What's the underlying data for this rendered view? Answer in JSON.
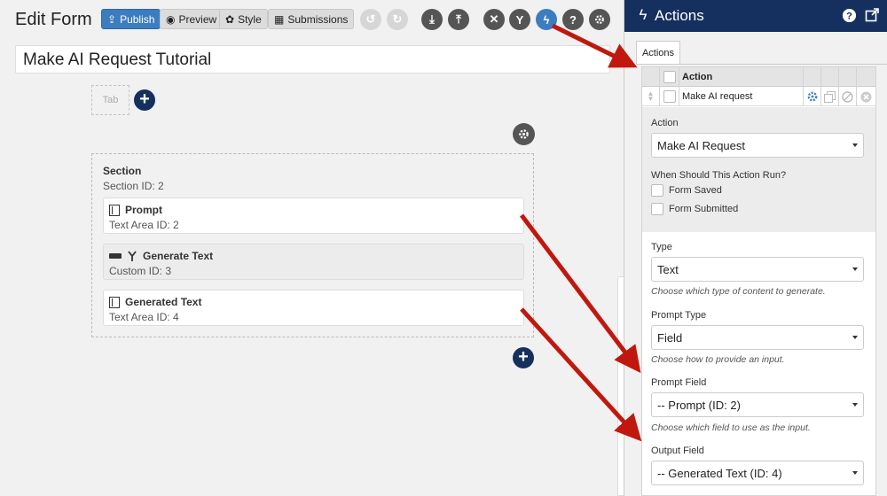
{
  "editor": {
    "title": "Edit Form",
    "toolbar": {
      "publish_label": "Publish",
      "preview_label": "Preview",
      "style_label": "Style",
      "submissions_label": "Submissions"
    },
    "form_title": "Make AI Request Tutorial",
    "tab_label": "Tab",
    "section": {
      "title": "Section",
      "subtitle": "Section  ID: 2",
      "fields": [
        {
          "name": "Prompt",
          "sub": "Text Area  ID: 2"
        },
        {
          "name": "Generate Text",
          "sub": "Custom  ID: 3"
        },
        {
          "name": "Generated Text",
          "sub": "Text Area  ID: 4"
        }
      ]
    }
  },
  "panel": {
    "title": "Actions",
    "tab_label": "Actions",
    "table": {
      "header": "Action",
      "rows": [
        {
          "name": "Make AI request"
        }
      ]
    },
    "action_label": "Action",
    "action_value": "Make AI Request",
    "when_label": "When Should This Action Run?",
    "when_options": [
      "Form Saved",
      "Form Submitted"
    ],
    "type_label": "Type",
    "type_value": "Text",
    "type_hint": "Choose which type of content to generate.",
    "prompt_type_label": "Prompt Type",
    "prompt_type_value": "Field",
    "prompt_type_hint": "Choose how to provide an input.",
    "prompt_field_label": "Prompt Field",
    "prompt_field_value": "-- Prompt (ID: 2)",
    "prompt_field_hint": "Choose which field to use as the input.",
    "output_field_label": "Output Field",
    "output_field_value": "-- Generated Text (ID: 4)"
  },
  "colors": {
    "accent": "#3b7dbf",
    "header_navy": "#15305e",
    "arrow_red": "#c0180e"
  }
}
